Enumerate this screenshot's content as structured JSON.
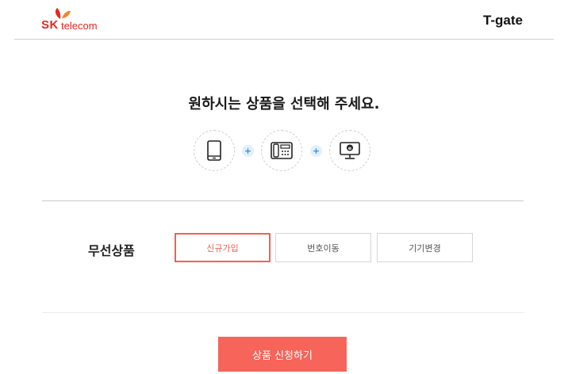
{
  "header": {
    "logo_sk": "SK",
    "logo_telecom": "telecom",
    "brand": "T-gate",
    "logo_color": "#e8261f"
  },
  "main": {
    "headline": "원하시는 상품을 선택해 주세요.",
    "product_icons": [
      "mobile-phone-icon",
      "home-phone-icon",
      "internet-tv-icon"
    ],
    "plus_symbol": "+",
    "section_label": "무선상품",
    "options": [
      {
        "label": "신규가입",
        "selected": true
      },
      {
        "label": "번호이동",
        "selected": false
      },
      {
        "label": "기기변경",
        "selected": false
      }
    ],
    "apply_button": "상품 신청하기"
  },
  "colors": {
    "accent": "#f26150",
    "button_bg": "#f6645a",
    "plus_bg": "#e3f0fb",
    "plus_fg": "#3b8fd9"
  }
}
